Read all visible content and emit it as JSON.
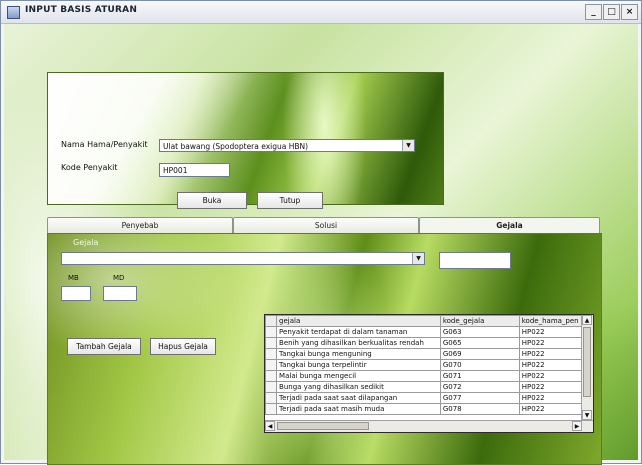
{
  "window": {
    "title": "INPUT BASIS ATURAN",
    "controls": [
      "_",
      "□",
      "×"
    ]
  },
  "form": {
    "nama_hama_label": "Nama Hama/Penyakit",
    "nama_hama_value": "Ulat bawang (Spodoptera exigua HBN)",
    "kode_penyakit_label": "Kode Penyakit",
    "kode_penyakit_value": "HP001",
    "buka_label": "Buka",
    "tutup_label": "Tutup"
  },
  "tabs": [
    {
      "label": "Penyebab",
      "active": false
    },
    {
      "label": "Solusi",
      "active": false
    },
    {
      "label": "Gejala",
      "active": true
    }
  ],
  "gejala_tab": {
    "gejala_label": "Gejala",
    "gejala_value": "",
    "code_value": "",
    "mb_label": "MB",
    "md_label": "MD",
    "mb_value": "",
    "md_value": "",
    "tambah_label": "Tambah Gejala",
    "hapus_label": "Hapus Gejala"
  },
  "grid": {
    "columns": [
      "gejala",
      "kode_gejala",
      "kode_hama_pen"
    ],
    "rows": [
      [
        "Penyakit terdapat di dalam tanaman",
        "G063",
        "HP022"
      ],
      [
        "Benih yang dihasilkan berkualitas rendah",
        "G065",
        "HP022"
      ],
      [
        "Tangkai bunga menguning",
        "G069",
        "HP022"
      ],
      [
        "Tangkai bunga terpelintir",
        "G070",
        "HP022"
      ],
      [
        "Malai bunga mengecil",
        "G071",
        "HP022"
      ],
      [
        "Bunga yang dihasilkan sedikit",
        "G072",
        "HP022"
      ],
      [
        "Terjadi pada saat saat dilapangan",
        "G077",
        "HP022"
      ],
      [
        "Terjadi pada saat masih muda",
        "G078",
        "HP022"
      ]
    ]
  },
  "icons": {
    "app": "window-app-icon",
    "dropdown": "dropdown-arrow-icon",
    "scroll_up": "scroll-up-icon",
    "scroll_down": "scroll-down-icon",
    "scroll_left": "scroll-left-icon",
    "scroll_right": "scroll-right-icon"
  }
}
